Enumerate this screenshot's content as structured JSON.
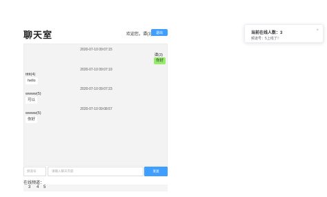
{
  "header": {
    "title": "聊天室",
    "welcome": "欢迎您，谭(3)",
    "logout_label": "退出"
  },
  "messages": [
    {
      "time": "2020-07-10 09:07:15",
      "user": "谭(3)",
      "text": "你好",
      "side": "right"
    },
    {
      "time": "2020-07-10 09:07:19",
      "user": "ttttt(4)",
      "text": "hello",
      "side": "left"
    },
    {
      "time": "2020-07-10 09:07:23",
      "user": "wwww(5)",
      "text": "可以",
      "side": "left"
    },
    {
      "time": "2020-07-10 09:08:57",
      "user": "wwww(5)",
      "text": "你好",
      "side": "left"
    }
  ],
  "input": {
    "channel_placeholder": "频道号",
    "message_placeholder": "请输入聊天内容",
    "send_label": "发送"
  },
  "online": {
    "label": "在线频道：",
    "channels": [
      "3",
      "4",
      "5"
    ]
  },
  "notification": {
    "title": "当前在线人数：3",
    "message": "频道号：5上线了！",
    "close": "×"
  },
  "colors": {
    "primary": "#409eff",
    "bubble_self": "#95ec69",
    "chat_bg": "#f3f3f3"
  }
}
